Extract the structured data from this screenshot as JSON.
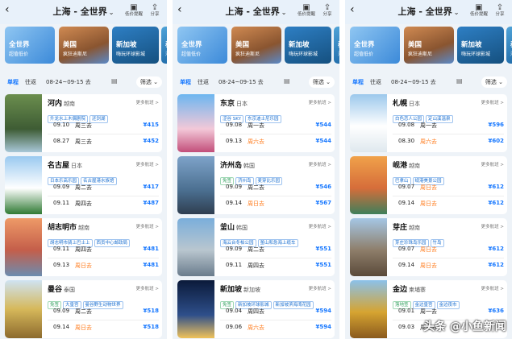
{
  "header": {
    "title": "上海 - 全世界",
    "caret": "⌄",
    "back_icon": "back-arrow-icon",
    "price_alert_label": "低价提醒",
    "share_label": "分享"
  },
  "banners": [
    {
      "title": "全世界",
      "subtitle": "超值低价"
    },
    {
      "title": "美国",
      "subtitle": "疯狂迪斯尼"
    },
    {
      "title": "新加坡",
      "subtitle": "嗨玩环球影城"
    },
    {
      "title": "泰",
      "subtitle": "海"
    }
  ],
  "tabs": {
    "one_way": "单程",
    "round_trip": "往返",
    "date_range": "08-24~09-15 去",
    "filter": "筛选"
  },
  "more_routes_label": "更多航班 >",
  "panels": [
    {
      "cards": [
        {
          "name": "河内",
          "country": "越南",
          "tags": [
            "升龙水上木偶剧院",
            "还剑湖"
          ],
          "flights": [
            {
              "date": "09.10",
              "day": "周三去",
              "orange": false,
              "price": "¥415"
            },
            {
              "date": "08.27",
              "day": "周三去",
              "orange": false,
              "price": "¥452"
            }
          ]
        },
        {
          "name": "名古屋",
          "country": "日本",
          "tags": [
            "日本乐高乐园",
            "名古屋港水族馆"
          ],
          "flights": [
            {
              "date": "09.09",
              "day": "周二去",
              "orange": false,
              "price": "¥417"
            },
            {
              "date": "09.11",
              "day": "周四去",
              "orange": false,
              "price": "¥487"
            }
          ]
        },
        {
          "name": "胡志明市",
          "country": "越南",
          "tags": [
            "胡志明市骑上巴士上",
            "西贡中心邮政局"
          ],
          "flights": [
            {
              "date": "09.11",
              "day": "周四去",
              "orange": false,
              "price": "¥481"
            },
            {
              "date": "09.13",
              "day": "周日去",
              "orange": true,
              "price": "¥481"
            }
          ]
        },
        {
          "name": "曼谷",
          "country": "泰国",
          "tags": [
            "免签",
            "大皇宫",
            "曼谷野生动物世界"
          ],
          "flights": [
            {
              "date": "09.09",
              "day": "周二去",
              "orange": false,
              "price": "¥518"
            },
            {
              "date": "09.14",
              "day": "周日去",
              "orange": true,
              "price": "¥518"
            }
          ]
        }
      ]
    },
    {
      "cards": [
        {
          "name": "东京",
          "country": "日本",
          "tags": [
            "涩谷 SKY",
            "东京迪士尼乐园"
          ],
          "flights": [
            {
              "date": "09.08",
              "day": "周一去",
              "orange": false,
              "price": "¥544"
            },
            {
              "date": "09.13",
              "day": "周六去",
              "orange": true,
              "price": "¥544"
            }
          ]
        },
        {
          "name": "济州岛",
          "country": "韩国",
          "tags": [
            "免签",
            "济州岛",
            "麦穿比乐园"
          ],
          "flights": [
            {
              "date": "09.09",
              "day": "周二去",
              "orange": false,
              "price": "¥546"
            },
            {
              "date": "09.14",
              "day": "周日去",
              "orange": true,
              "price": "¥567"
            }
          ]
        },
        {
          "name": "釜山",
          "country": "韩国",
          "tags": [
            "海云台冬柏公园",
            "釜山和急海上缆车"
          ],
          "flights": [
            {
              "date": "09.09",
              "day": "周二去",
              "orange": false,
              "price": "¥551"
            },
            {
              "date": "09.11",
              "day": "周四去",
              "orange": false,
              "price": "¥551"
            }
          ]
        },
        {
          "name": "新加坡",
          "country": "新加坡",
          "tags": [
            "免签",
            "新加坡环球影城",
            "新加坡滨海湾花园"
          ],
          "flights": [
            {
              "date": "09.04",
              "day": "周四去",
              "orange": false,
              "price": "¥594"
            },
            {
              "date": "09.06",
              "day": "周六去",
              "orange": true,
              "price": "¥594"
            }
          ]
        }
      ]
    },
    {
      "cards": [
        {
          "name": "札幌",
          "country": "日本",
          "tags": [
            "白色恋人公园",
            "定山溪温泉"
          ],
          "flights": [
            {
              "date": "09.08",
              "day": "周一去",
              "orange": false,
              "price": "¥596"
            },
            {
              "date": "08.30",
              "day": "周六去",
              "orange": true,
              "price": "¥602"
            }
          ]
        },
        {
          "name": "岘港",
          "country": "越南",
          "tags": [
            "巴拿山",
            "岘港美景公园"
          ],
          "flights": [
            {
              "date": "09.07",
              "day": "周日去",
              "orange": true,
              "price": "¥612"
            },
            {
              "date": "09.14",
              "day": "周日去",
              "orange": true,
              "price": "¥612"
            }
          ]
        },
        {
          "name": "芽庄",
          "country": "越南",
          "tags": [
            "芽庄珍珠岛乐园",
            "竹岛"
          ],
          "flights": [
            {
              "date": "09.07",
              "day": "周日去",
              "orange": true,
              "price": "¥612"
            },
            {
              "date": "09.14",
              "day": "周日去",
              "orange": true,
              "price": "¥612"
            }
          ]
        },
        {
          "name": "金边",
          "country": "柬埔寨",
          "tags": [
            "落地签",
            "金边皇宫",
            "金边夜市"
          ],
          "flights": [
            {
              "date": "09.01",
              "day": "周一去",
              "orange": false,
              "price": "¥636"
            },
            {
              "date": "09.03",
              "day": "周三去",
              "orange": false,
              "price": ""
            }
          ]
        }
      ]
    }
  ],
  "watermark": "头条 @小鱼新闻"
}
